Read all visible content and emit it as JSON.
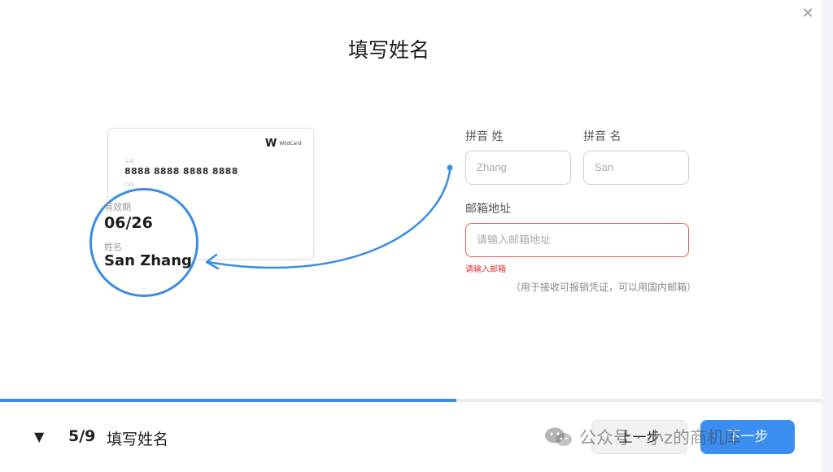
{
  "dialog": {
    "title": "填写姓名",
    "close_icon": "close-icon"
  },
  "card": {
    "brand_logo": "W",
    "brand_name": "WildCard",
    "number_label": "卡号",
    "number": "8888 8888 8888 8888",
    "cvv_label": "CVV",
    "expiry_label": "有效期",
    "expiry": "06/26",
    "name_label": "姓名",
    "name": "San Zhang"
  },
  "form": {
    "last_name_label": "拼音 姓",
    "last_name_placeholder": "Zhang",
    "first_name_label": "拼音 名",
    "first_name_placeholder": "San",
    "email_label": "邮箱地址",
    "email_placeholder": "请输入邮箱地址",
    "email_error": "请输入邮箱",
    "email_hint": "（用于接收可报销凭证，可以用国内邮箱）"
  },
  "progress": {
    "current": 5,
    "total": 9
  },
  "footer": {
    "step_text": "5/9",
    "step_title": "填写姓名",
    "prev_label": "上一步",
    "next_label": "下一步"
  },
  "watermark": {
    "text": "公众号 · 小z的商机库"
  },
  "colors": {
    "accent": "#3b8ef0",
    "error": "#e03131"
  }
}
